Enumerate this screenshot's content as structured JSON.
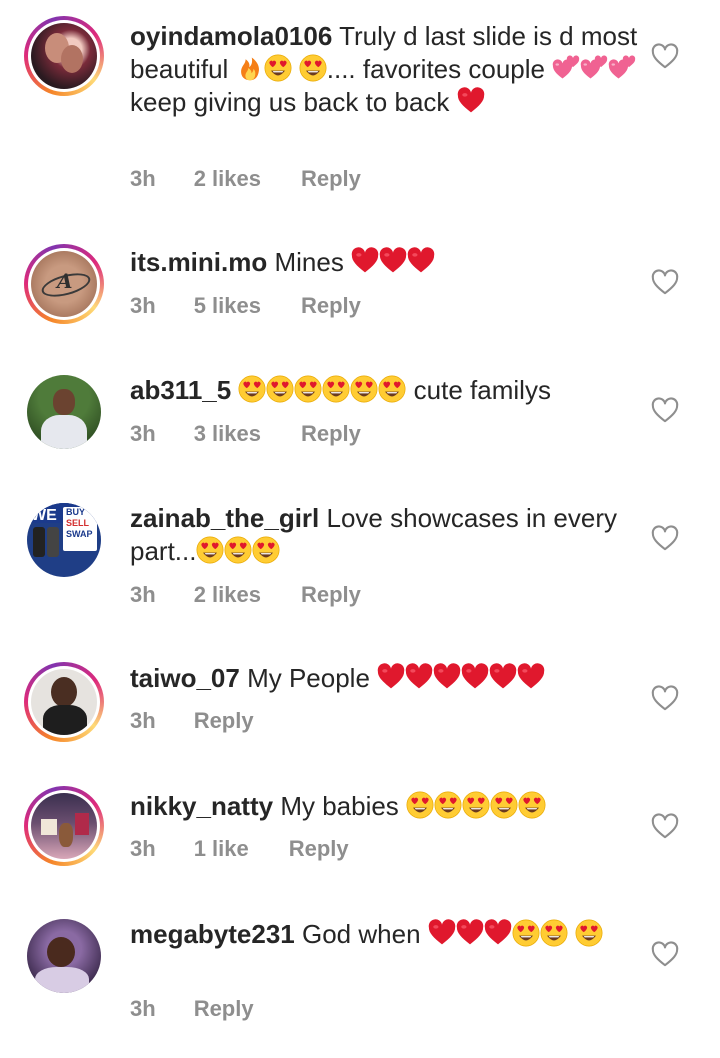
{
  "comments": [
    {
      "username": "oyindamola0106",
      "text": [
        "Truly d last slide is d most beautiful ",
        " ",
        ".... favorites couple ",
        " keep giving us back to back "
      ],
      "time": "3h",
      "likes": "2 likes",
      "reply": "Reply",
      "emojis": [
        "fire-emoji",
        "heart-eyes-emoji",
        "heart-eyes-emoji",
        "two-hearts-emoji",
        "two-hearts-emoji",
        "two-hearts-emoji",
        "red-heart-emoji"
      ]
    },
    {
      "username": "its.mini.mo",
      "text": [
        "Mines "
      ],
      "time": "3h",
      "likes": "5 likes",
      "reply": "Reply",
      "emojis": [
        "red-heart-emoji",
        "red-heart-emoji",
        "red-heart-emoji"
      ]
    },
    {
      "username": "ab311_5",
      "text": [
        " cute familys"
      ],
      "time": "3h",
      "likes": "3 likes",
      "reply": "Reply",
      "emojis": [
        "heart-eyes-emoji",
        "heart-eyes-emoji",
        "heart-eyes-emoji",
        "heart-eyes-emoji",
        "heart-eyes-emoji",
        "heart-eyes-emoji"
      ]
    },
    {
      "username": "zainab_the_girl",
      "text": [
        "Love showcases in every part..."
      ],
      "time": "3h",
      "likes": "2 likes",
      "reply": "Reply",
      "emojis": [
        "heart-eyes-emoji",
        "heart-eyes-emoji",
        "heart-eyes-emoji"
      ],
      "avatar_text": [
        "WE",
        "BUY",
        "SELL",
        "SWAP"
      ]
    },
    {
      "username": "taiwo_07",
      "text": [
        "My People "
      ],
      "time": "3h",
      "likes": "",
      "reply": "Reply",
      "emojis": [
        "red-heart-emoji",
        "red-heart-emoji",
        "red-heart-emoji",
        "red-heart-emoji",
        "red-heart-emoji",
        "red-heart-emoji"
      ]
    },
    {
      "username": "nikky_natty",
      "text": [
        "My babies "
      ],
      "time": "3h",
      "likes": "1 like",
      "reply": "Reply",
      "emojis": [
        "heart-eyes-emoji",
        "heart-eyes-emoji",
        "heart-eyes-emoji",
        "heart-eyes-emoji",
        "heart-eyes-emoji"
      ]
    },
    {
      "username": "megabyte231",
      "text": [
        "God when "
      ],
      "time": "3h",
      "likes": "",
      "reply": "Reply",
      "emojis": [
        "red-heart-emoji",
        "red-heart-emoji",
        "red-heart-emoji",
        "heart-eyes-emoji",
        "heart-eyes-emoji",
        "heart-eyes-emoji"
      ]
    }
  ],
  "colors": {
    "text": "#262626",
    "meta": "#8e8e8e",
    "heart_emoji": "#e0182d",
    "emoji_face": "#ffcc33",
    "ring": [
      "#f58529",
      "#dd2a7b",
      "#8134af"
    ]
  },
  "icons": {
    "like_button": "heart-outline-icon"
  }
}
